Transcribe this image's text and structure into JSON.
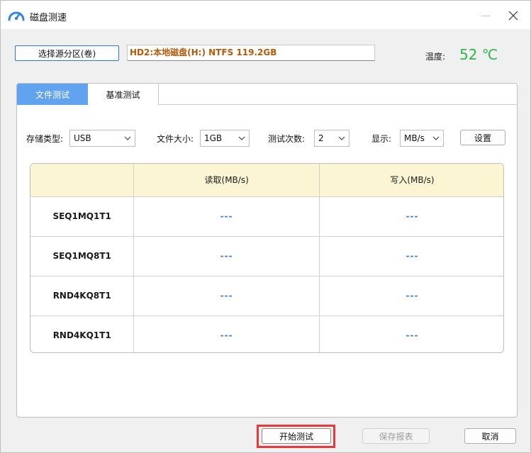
{
  "window": {
    "title": "磁盘测速"
  },
  "source": {
    "button_label": "选择源分区(卷)",
    "disk_value": "HD2:本地磁盘(H:) NTFS 119.2GB"
  },
  "temperature": {
    "label": "温度:",
    "value": "52 ℃"
  },
  "tabs": [
    {
      "label": "文件测试",
      "active": true
    },
    {
      "label": "基准测试",
      "active": false
    }
  ],
  "options": {
    "storage_type": {
      "label": "存储类型:",
      "value": "USB"
    },
    "file_size": {
      "label": "文件大小:",
      "value": "1GB"
    },
    "test_count": {
      "label": "测试次数:",
      "value": "2"
    },
    "display": {
      "label": "显示:",
      "value": "MB/s"
    },
    "settings_label": "设置"
  },
  "results": {
    "headers": [
      "",
      "读取(MB/s)",
      "写入(MB/s)"
    ],
    "rows": [
      {
        "name": "SEQ1MQ1T1",
        "read": "---",
        "write": "---"
      },
      {
        "name": "SEQ1MQ8T1",
        "read": "---",
        "write": "---"
      },
      {
        "name": "RND4KQ8T1",
        "read": "---",
        "write": "---"
      },
      {
        "name": "RND4KQ1T1",
        "read": "---",
        "write": "---"
      }
    ]
  },
  "footer": {
    "start_label": "开始测试",
    "save_label": "保存报表",
    "cancel_label": "取消"
  },
  "colors": {
    "accent_tab": "#62a3ef",
    "temperature": "#2db84a",
    "disk_text": "#b8590a",
    "highlight": "#e8393c",
    "dash": "#3a7be0"
  }
}
